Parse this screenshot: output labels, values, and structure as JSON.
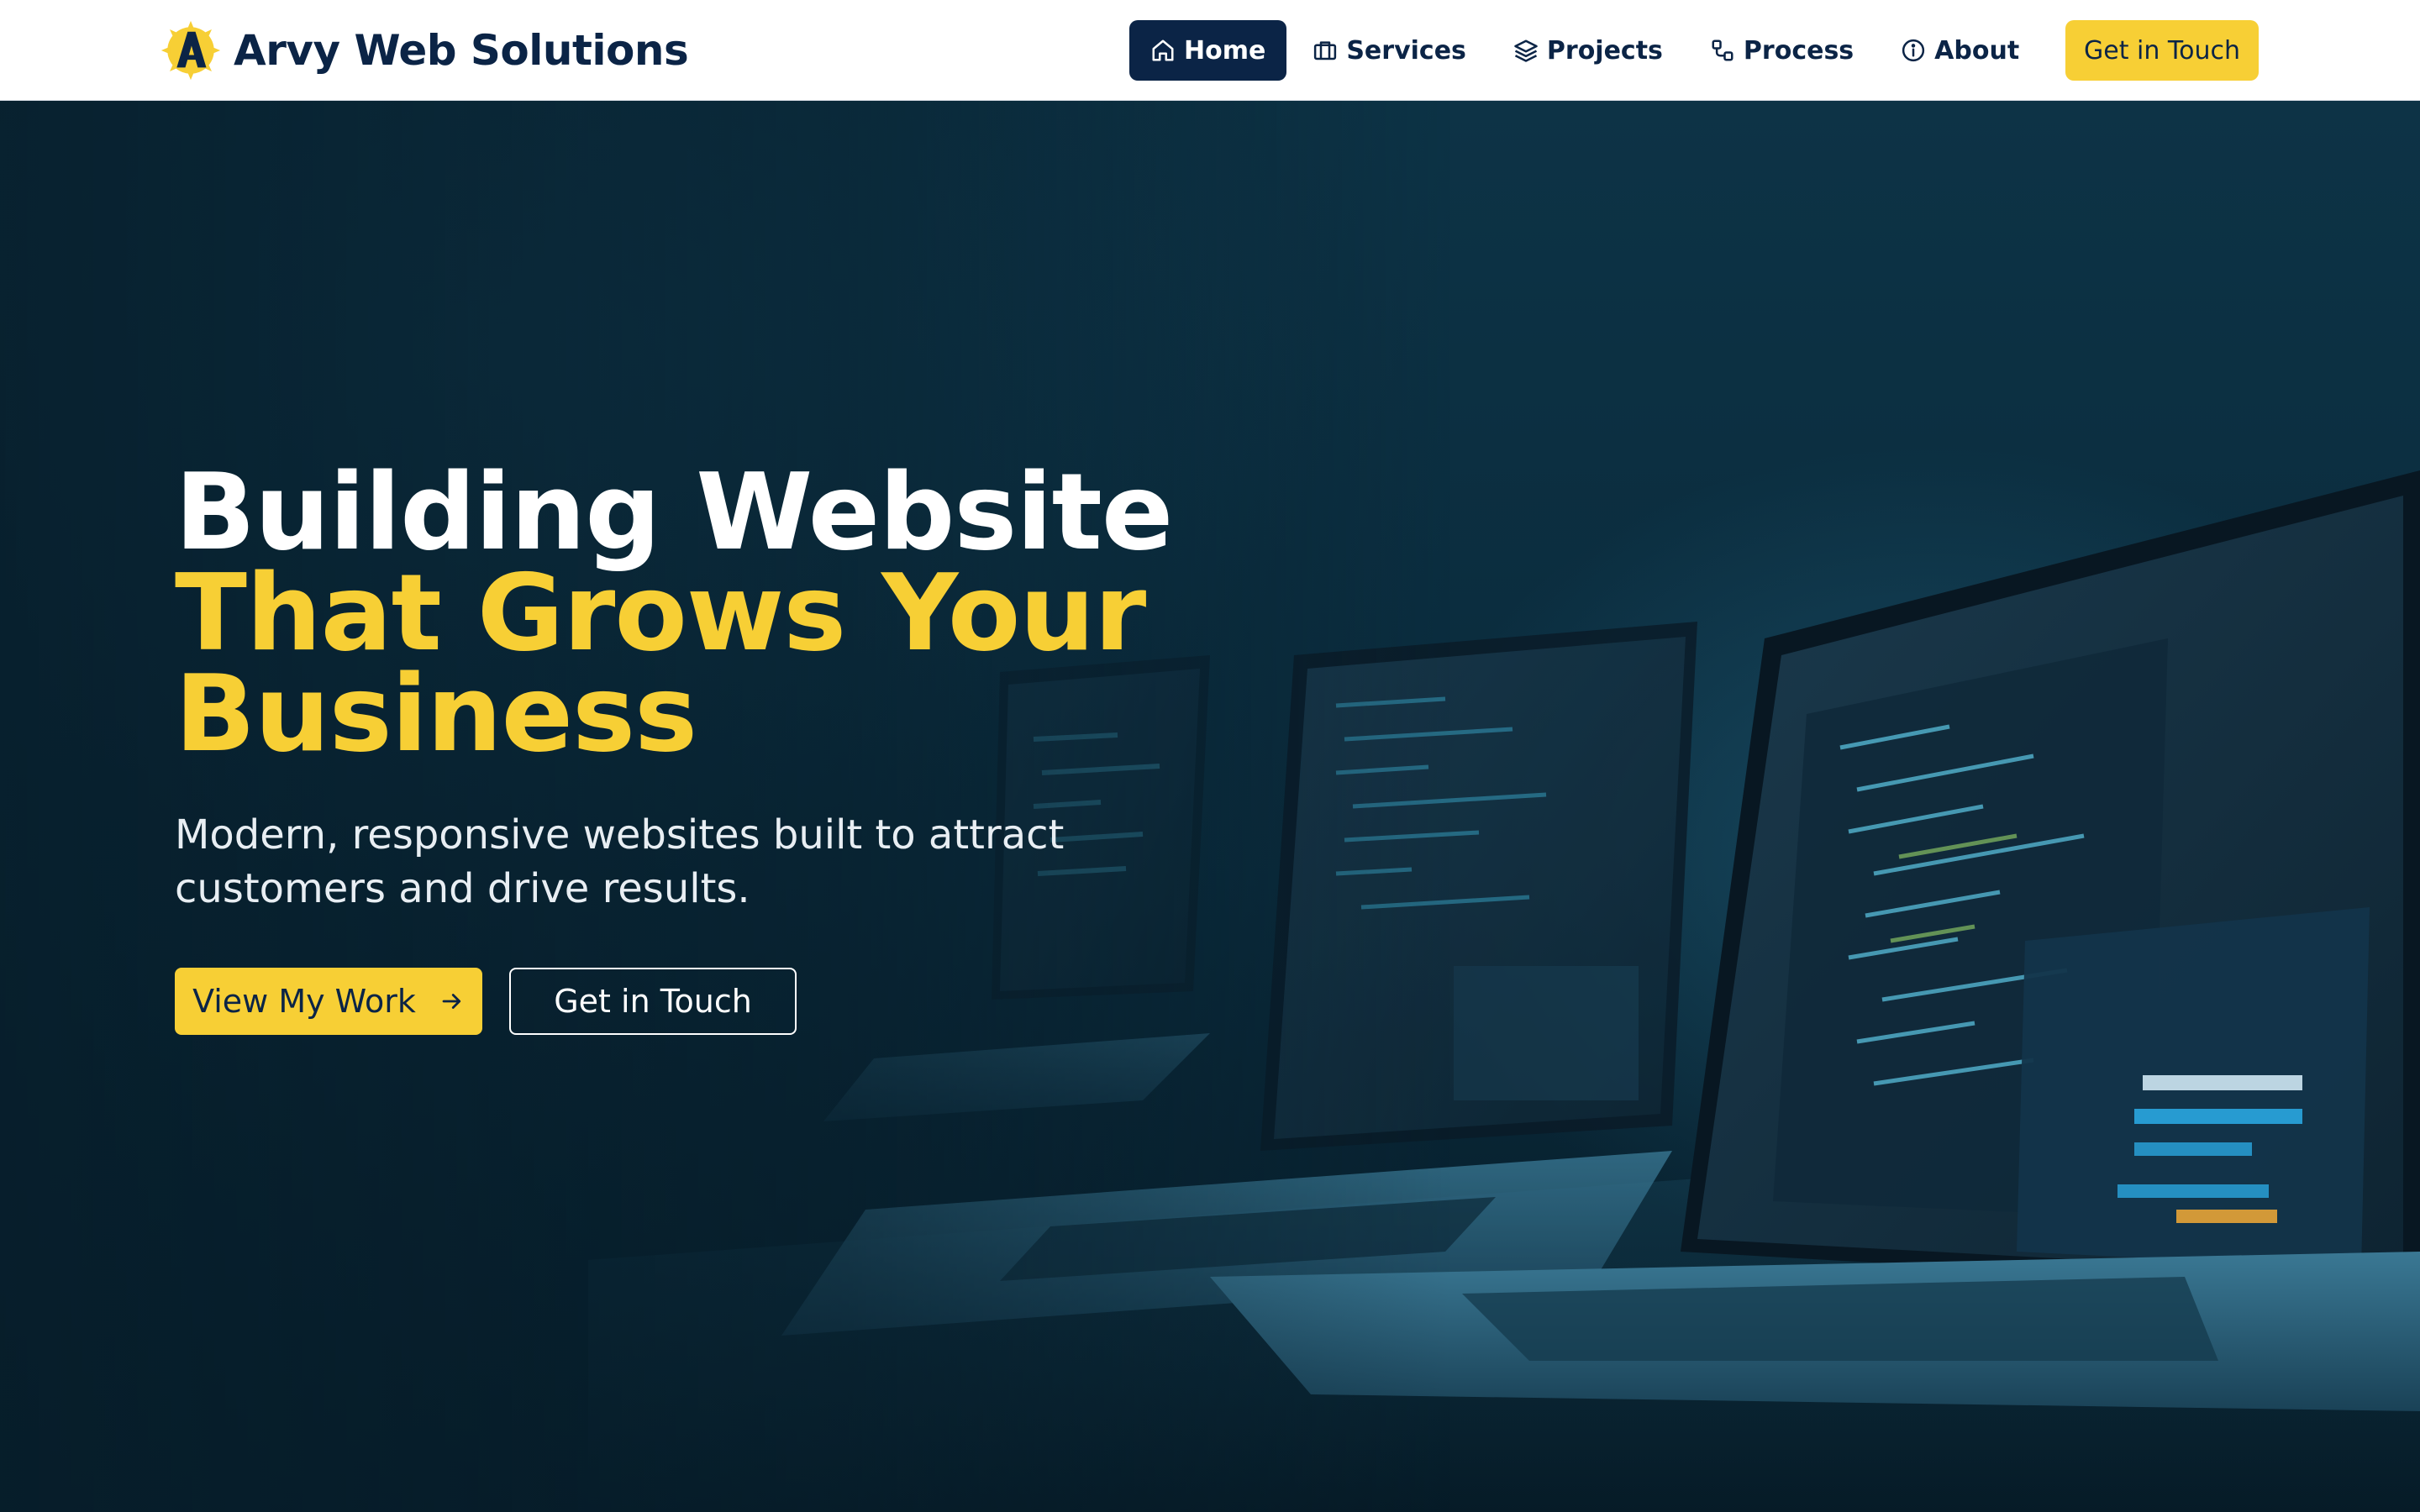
{
  "brand": {
    "name": "Arvy Web Solutions",
    "logo_icon": "arvy-logo-icon"
  },
  "nav": {
    "items": [
      {
        "label": "Home",
        "icon": "home-icon",
        "active": true
      },
      {
        "label": "Services",
        "icon": "briefcase-icon",
        "active": false
      },
      {
        "label": "Projects",
        "icon": "layers-icon",
        "active": false
      },
      {
        "label": "Process",
        "icon": "workflow-icon",
        "active": false
      },
      {
        "label": "About",
        "icon": "info-icon",
        "active": false
      }
    ],
    "cta_label": "Get in Touch"
  },
  "hero": {
    "title_line1": "Building Website",
    "title_line2": "That Grows Your",
    "title_line3": "Business",
    "subtitle": "Modern, responsive websites built to attract customers and drive results.",
    "primary_button": "View My Work",
    "primary_button_icon": "arrow-right-icon",
    "secondary_button": "Get in Touch",
    "background_image": "laptops-with-code-illustration"
  },
  "colors": {
    "navy": "#0b2446",
    "accent_yellow": "#f7cf35",
    "hero_background": "#0b2a3a",
    "white": "#ffffff"
  }
}
